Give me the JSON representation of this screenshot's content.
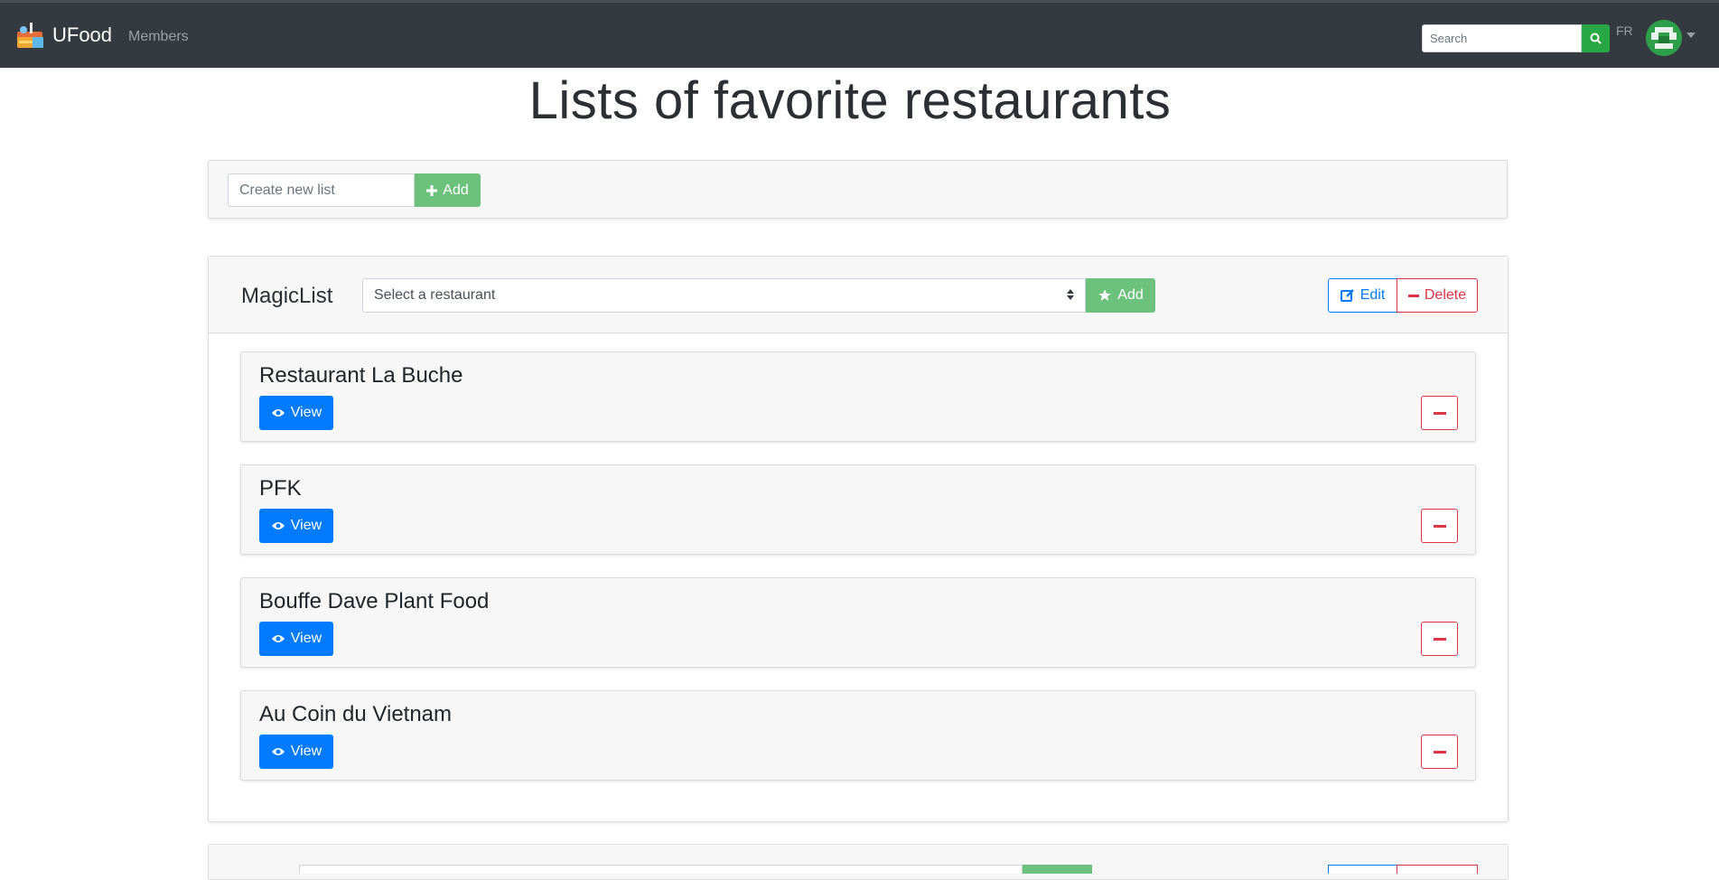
{
  "navbar": {
    "brand": "UFood",
    "members_link": "Members",
    "search_placeholder": "Search",
    "lang": "FR",
    "bg_color": "#343a40",
    "search_icon": "search-icon"
  },
  "page": {
    "title": "Lists of favorite restaurants"
  },
  "create": {
    "placeholder": "Create new list",
    "add_label": "Add"
  },
  "lists": [
    {
      "name": "MagicList",
      "select_placeholder": "Select a restaurant",
      "add_label": "Add",
      "edit_label": "Edit",
      "delete_label": "Delete",
      "restaurants": [
        {
          "name": "Restaurant La Buche",
          "view_label": "View"
        },
        {
          "name": "PFK",
          "view_label": "View"
        },
        {
          "name": "Bouffe Dave Plant Food",
          "view_label": "View"
        },
        {
          "name": "Au Coin du Vietnam",
          "view_label": "View"
        }
      ]
    }
  ],
  "colors": {
    "primary": "#007bff",
    "success": "#28a745",
    "success_light": "#6cc27d",
    "danger": "#dc3545"
  }
}
